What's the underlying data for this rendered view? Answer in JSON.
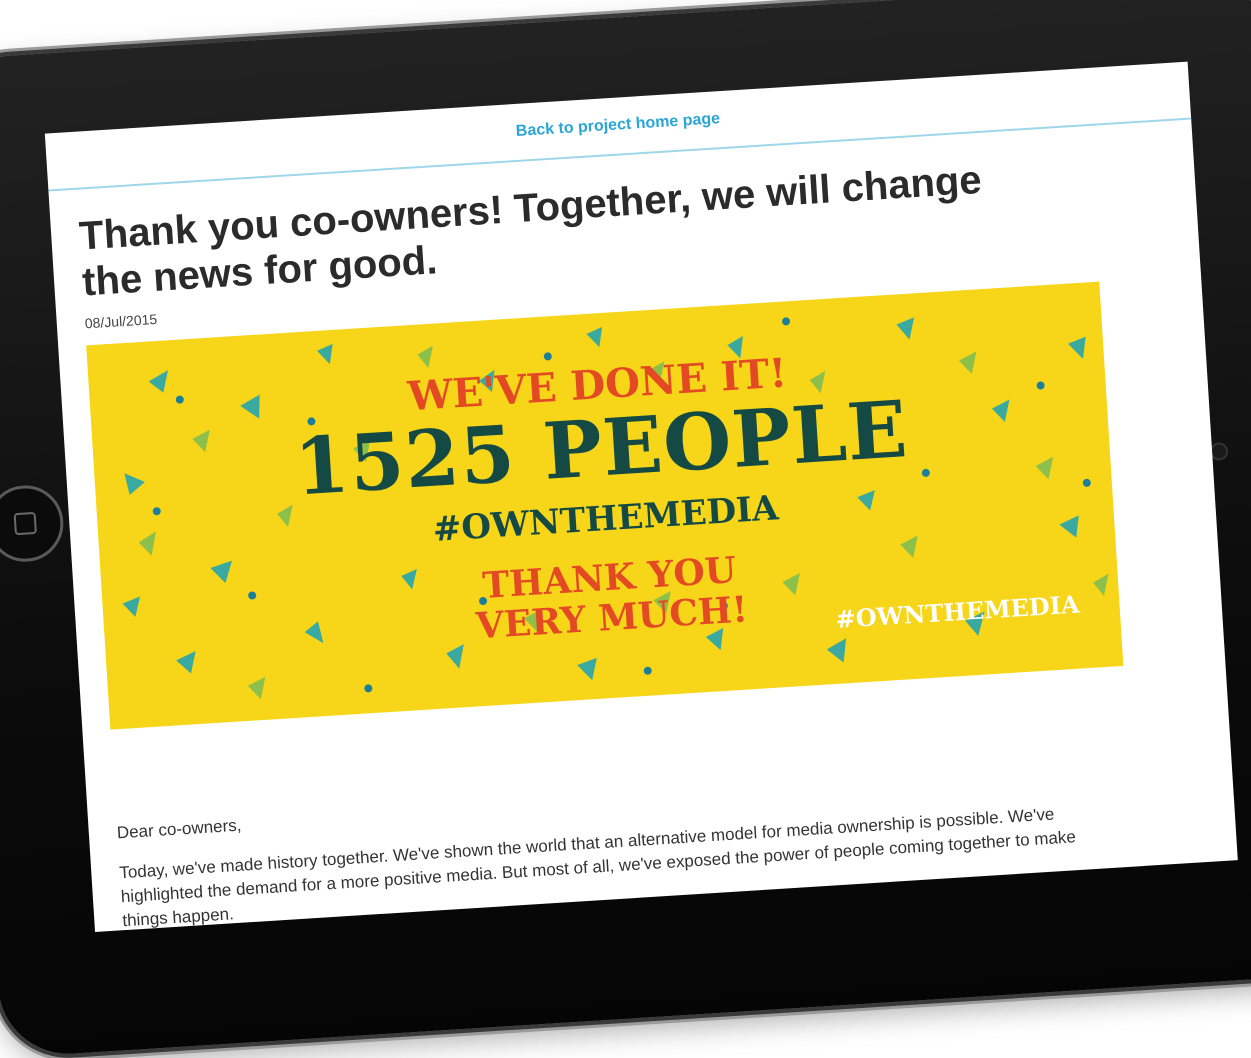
{
  "nav": {
    "back_link": "Back to project home page"
  },
  "article": {
    "title": "Thank you co-owners! Together, we will change the news for good.",
    "date": "08/Jul/2015",
    "banner": {
      "line1": "WE'VE DONE IT!",
      "line2": "1525 PEOPLE",
      "line3": "#OWNTHEMEDIA",
      "line4": "THANK YOU",
      "line5": "VERY MUCH!",
      "tag": "#OWNTHEMEDIA"
    },
    "salutation": "Dear co-owners,",
    "body": "Today, we've made history together. We've shown the world that an alternative model for media ownership is possible. We've highlighted the demand for a more positive media. But most of all, we've exposed the power of people coming together to make things happen."
  },
  "colors": {
    "banner_yellow": "#f7d519",
    "banner_red": "#e34a24",
    "banner_teal": "#154a44",
    "link_blue": "#2aa6d6"
  }
}
